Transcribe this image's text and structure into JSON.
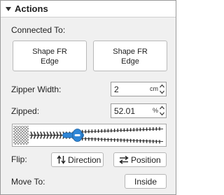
{
  "header": {
    "title": "Actions"
  },
  "connected_to": {
    "label": "Connected To:",
    "buttons": [
      {
        "line1": "Shape FR",
        "line2": "Edge"
      },
      {
        "line1": "Shape FR",
        "line2": "Edge"
      }
    ]
  },
  "zipper_width": {
    "label": "Zipper Width:",
    "value": "2",
    "unit": "cm"
  },
  "zipped": {
    "label": "Zipped:",
    "value": "52.01",
    "unit": "%",
    "level_percent": 52.01
  },
  "flip": {
    "label": "Flip:",
    "direction_label": "Direction",
    "position_label": "Position"
  },
  "move_to": {
    "label": "Move To:",
    "inside_label": "Inside"
  },
  "colors": {
    "accent": "#2f86d6",
    "panel_bg": "#f0f0f0"
  }
}
